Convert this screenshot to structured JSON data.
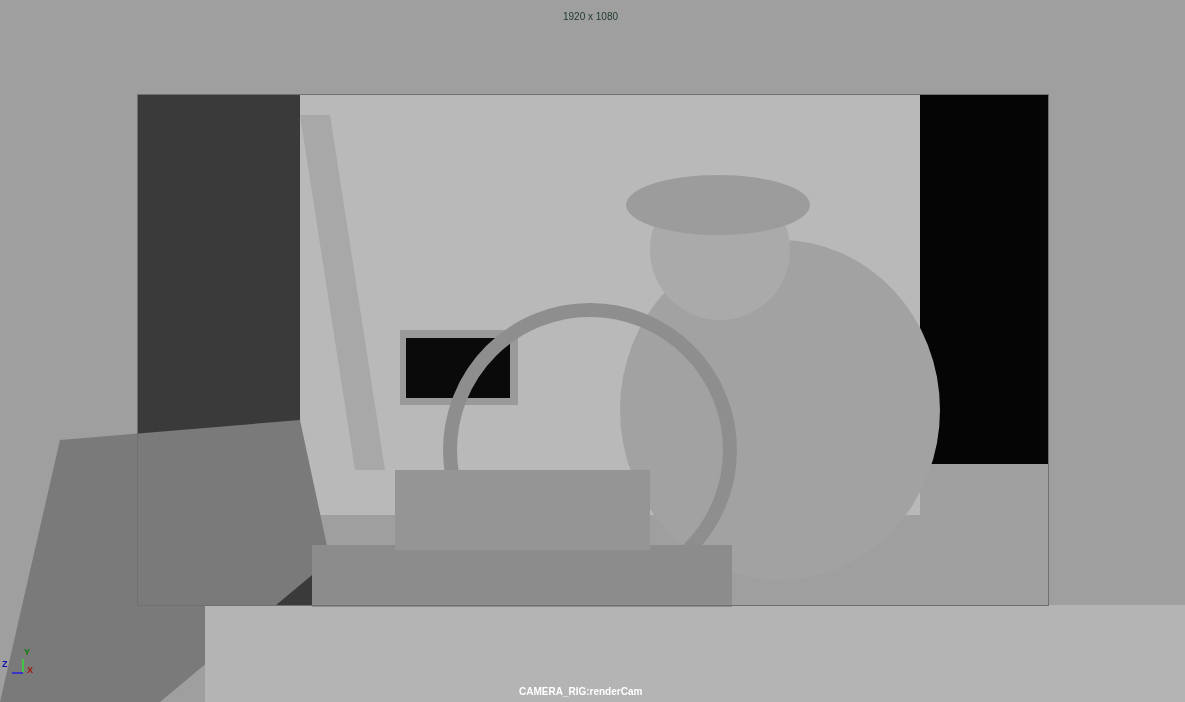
{
  "viewport": {
    "resolution_label": "1920 x 1080",
    "camera_label": "CAMERA_RIG:renderCam",
    "axes": [
      {
        "label": "Y"
      },
      {
        "label": "Z"
      },
      {
        "label": "X"
      }
    ]
  }
}
